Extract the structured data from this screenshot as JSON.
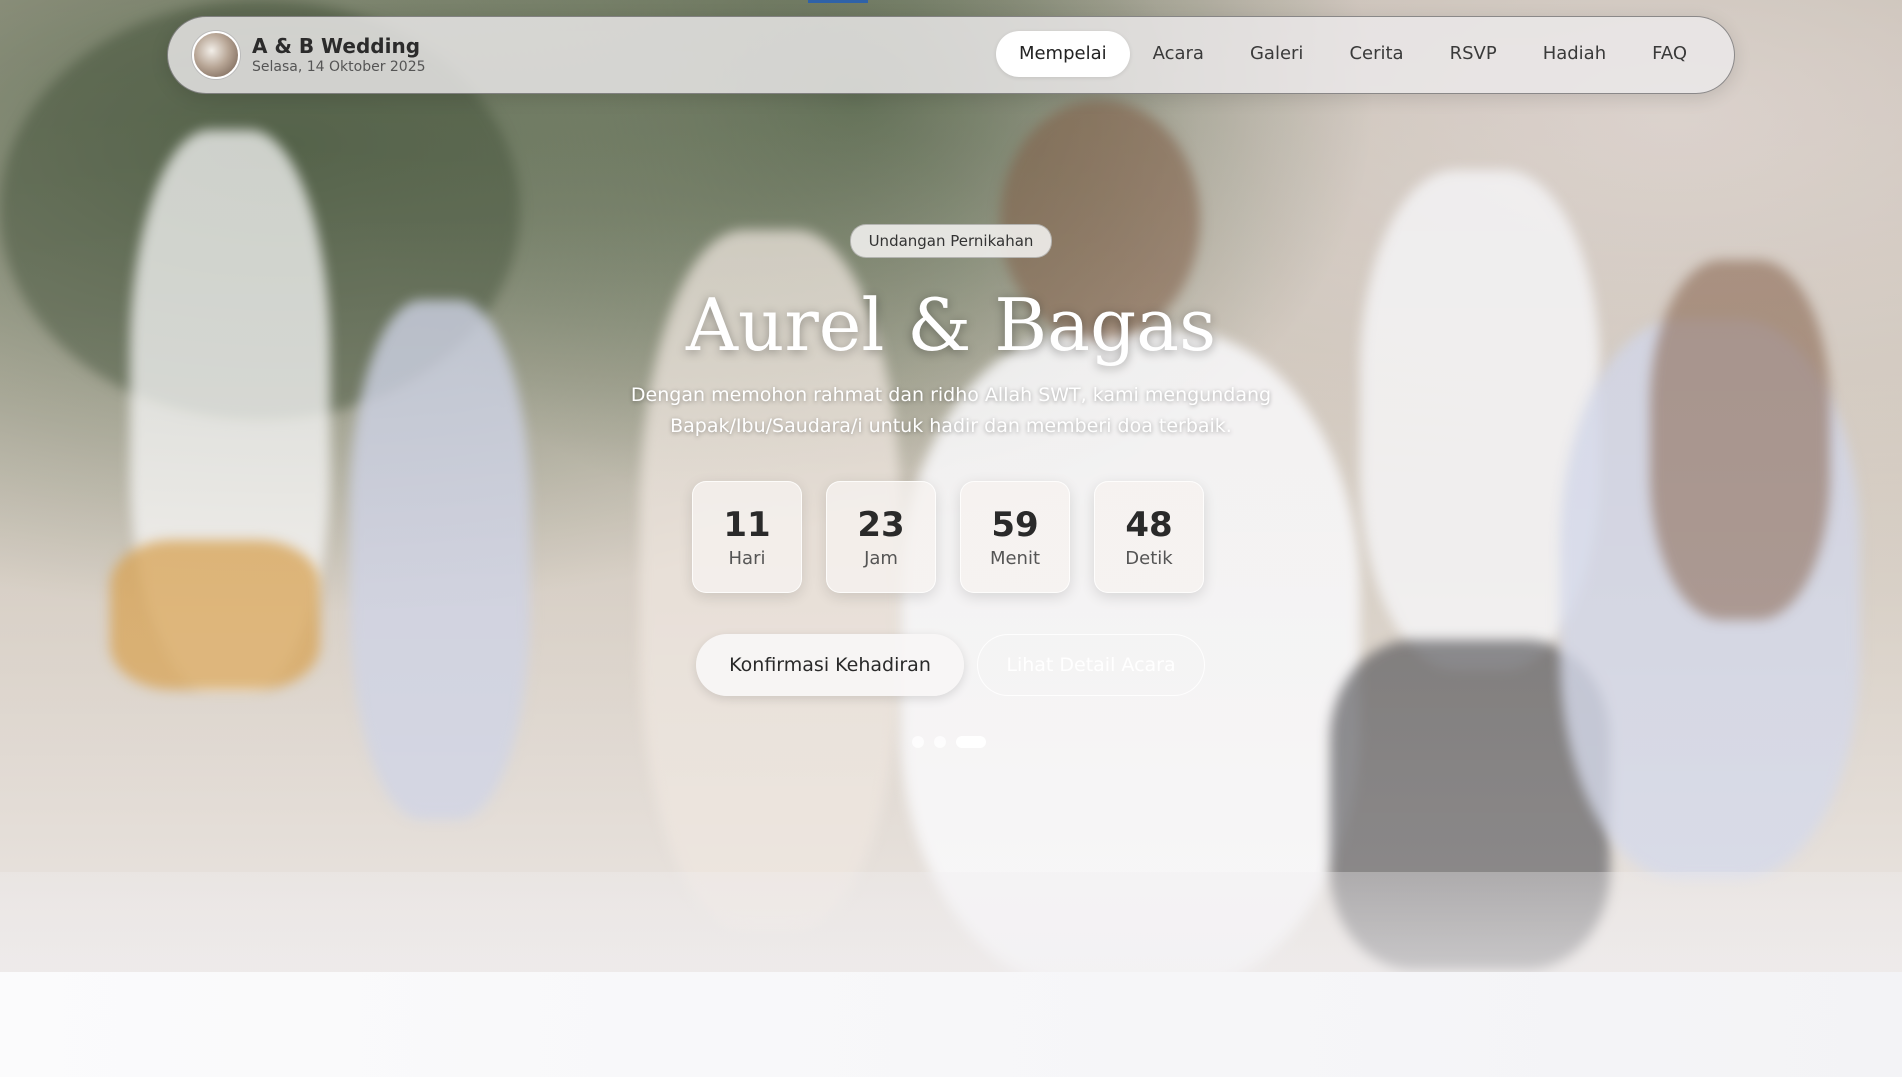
{
  "brand": {
    "title": "A & B Wedding",
    "date": "Selasa, 14 Oktober 2025",
    "avatar_icon": "couple-photo-avatar"
  },
  "nav": {
    "items": [
      {
        "label": "Mempelai",
        "active": true
      },
      {
        "label": "Acara"
      },
      {
        "label": "Galeri"
      },
      {
        "label": "Cerita"
      },
      {
        "label": "RSVP"
      },
      {
        "label": "Hadiah"
      },
      {
        "label": "FAQ"
      }
    ]
  },
  "hero": {
    "badge": "Undangan Pernikahan",
    "title": "Aurel & Bagas",
    "subtitle": "Dengan memohon rahmat dan ridho Allah SWT, kami mengundang Bapak/Ibu/Saudara/i untuk hadir dan memberi doa terbaik.",
    "countdown": [
      {
        "value": "11",
        "label": "Hari"
      },
      {
        "value": "23",
        "label": "Jam"
      },
      {
        "value": "59",
        "label": "Menit"
      },
      {
        "value": "48",
        "label": "Detik"
      }
    ],
    "primary_button": "Konfirmasi Kehadiran",
    "secondary_button": "Lihat Detail Acara",
    "slides": {
      "count": 3,
      "active_index": 2
    }
  },
  "colors": {
    "accent": "#2f62a8",
    "title_text": "#ffffff",
    "navbar_bg": "#ebe9ea"
  }
}
